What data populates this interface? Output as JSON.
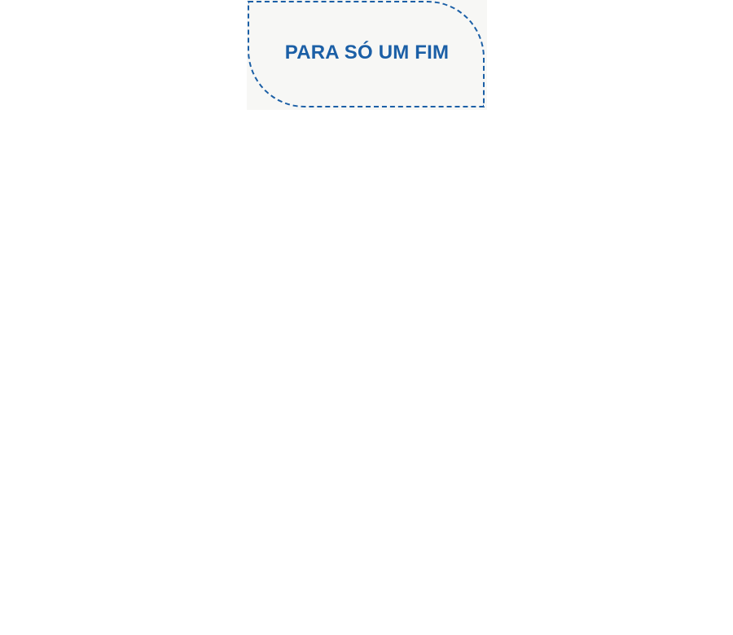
{
  "badge": {
    "text": "PARA SÓ UM FIM",
    "text_color": "#1b5fa6",
    "border_color": "#1b5fa6",
    "background_color": "#f7f7f5"
  }
}
